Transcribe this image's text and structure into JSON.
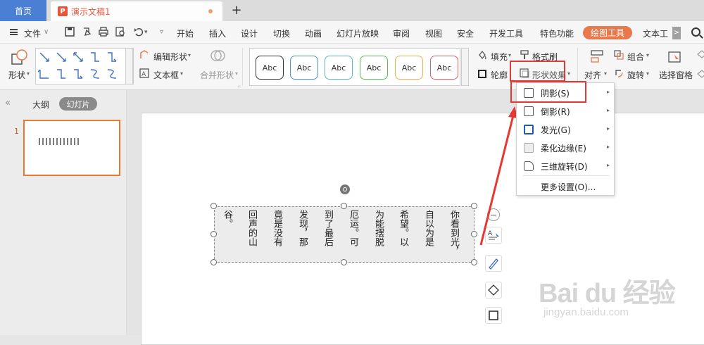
{
  "tabs": {
    "home": "首页",
    "document": "演示文稿1",
    "new_tab": "+"
  },
  "menu": {
    "file": "文件",
    "items": [
      "开始",
      "插入",
      "设计",
      "切换",
      "动画",
      "幻灯片放映",
      "审阅",
      "视图",
      "安全",
      "开发工具",
      "特色功能"
    ],
    "drawing_tools": "绘图工具",
    "text_tools": "文本工",
    "more": ">"
  },
  "ribbon": {
    "shape": "形状",
    "edit_shape": "编辑形状",
    "text_box": "文本框",
    "merge_shape": "合并形状",
    "style_samples": [
      "Abc",
      "Abc",
      "Abc",
      "Abc",
      "Abc",
      "Abc"
    ],
    "style_colors": [
      "#333333",
      "#4a90d9",
      "#5ab4c9",
      "#5cb85c",
      "#f0ad4e",
      "#e06060"
    ],
    "fill": "填充",
    "format_painter": "格式刷",
    "outline": "轮廓",
    "shape_effect": "形状效果",
    "group": "组合",
    "align": "对齐",
    "rotate": "旋转",
    "selection_pane": "选择窗格"
  },
  "left_panel": {
    "outline_tab": "大纲",
    "slides_tab": "幻灯片",
    "slide_number": "1"
  },
  "textbox": {
    "columns": [
      "你看到光，",
      "自以为是",
      "希望。以",
      "为能摆脱",
      "厄运。可",
      "到了最后",
      "发现，那",
      "竟是没有",
      "回声的山",
      "谷。"
    ]
  },
  "dropdown": {
    "items": [
      {
        "label": "阴影(S)",
        "icon": "shadow-icon",
        "has_submenu": true
      },
      {
        "label": "倒影(R)",
        "icon": "reflection-icon",
        "has_submenu": true
      },
      {
        "label": "发光(G)",
        "icon": "glow-icon",
        "has_submenu": true
      },
      {
        "label": "柔化边缘(E)",
        "icon": "soft-edge-icon",
        "has_submenu": true
      },
      {
        "label": "三维旋转(D)",
        "icon": "3d-rotate-icon",
        "has_submenu": true
      },
      {
        "label": "更多设置(O)...",
        "icon": "",
        "has_submenu": false
      }
    ]
  },
  "watermark": {
    "logo": "Bai du 经验",
    "url": "jingyan.baidu.com"
  },
  "colors": {
    "accent_orange": "#e8794c",
    "tab_blue": "#4a7fd4",
    "highlight_red": "#e53935"
  }
}
